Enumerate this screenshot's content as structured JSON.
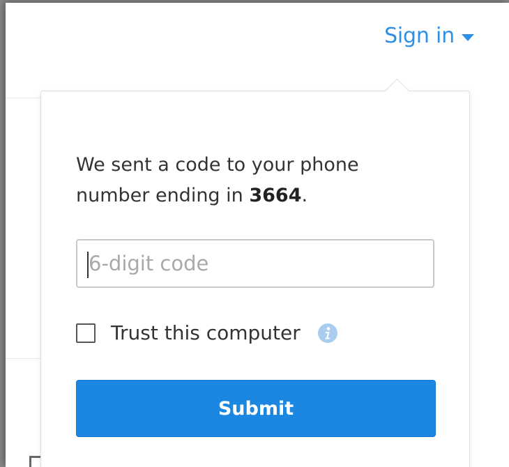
{
  "header": {
    "signin_label": "Sign in",
    "accent_color": "#2e8fe6"
  },
  "popover": {
    "message_prefix": "We sent a code to your phone number ending in ",
    "phone_ending": "3664",
    "message_suffix": ".",
    "code_input": {
      "placeholder": "6-digit code",
      "value": ""
    },
    "trust": {
      "label": "Trust this computer",
      "checked": false,
      "info_icon": "info-icon"
    },
    "submit_label": "Submit",
    "submit_color": "#1c87e0"
  }
}
